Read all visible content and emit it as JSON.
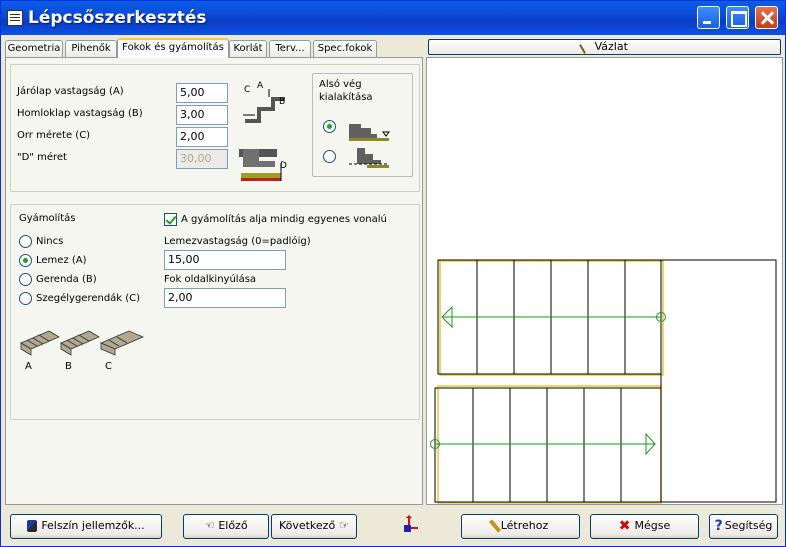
{
  "window": {
    "title": "Lépcsőszerkesztés"
  },
  "tabs": [
    "Geometria",
    "Pihenők",
    "Fokok és gyámolítás",
    "Korlát",
    "Terv...",
    "Spec.fokok"
  ],
  "top_group": {
    "fields": [
      {
        "label": "Járólap vastagság (A)",
        "value": "5,00"
      },
      {
        "label": "Homloklap vastagság (B)",
        "value": "3,00"
      },
      {
        "label": "Orr mérete (C)",
        "value": "2,00"
      },
      {
        "label": "\"D\" méret",
        "value": "30,00"
      }
    ],
    "diagram_labels": {
      "c": "C",
      "a": "A",
      "b": "B",
      "d": "D"
    },
    "also_veg": {
      "title": "Alsó vég kialakítása"
    }
  },
  "support": {
    "title": "Gyámolítás",
    "options": [
      "Nincs",
      "Lemez (A)",
      "Gerenda (B)",
      "Szegélygerendák (C)"
    ],
    "selected": 1,
    "checkbox_label": "A gyámolítás alja mindig egyenes vonalú",
    "plate_label": "Lemezvastagság (0=padlóig)",
    "plate_value": "15,00",
    "overhang_label": "Fok oldalkinyúlása",
    "overhang_value": "2,00",
    "pics": [
      "A",
      "B",
      "C"
    ]
  },
  "buttons": {
    "sketch": "Vázlat",
    "surface": "Felszín jellemzők...",
    "prev": "Előző",
    "next": "Következő",
    "create": "Létrehoz",
    "cancel": "Mégse",
    "help": "Segítség"
  },
  "colors": {
    "title_bar": "#0a5fe8",
    "accent_green": "#21a121",
    "stair_line": "#1a9a1a",
    "stair_outline": "#e8c832"
  }
}
